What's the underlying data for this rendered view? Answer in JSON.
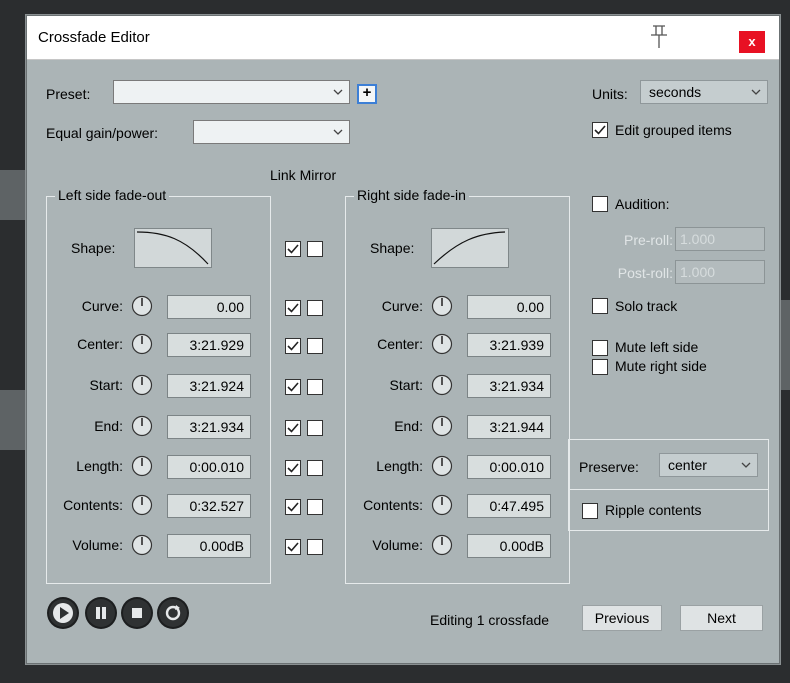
{
  "window": {
    "title": "Crossfade Editor",
    "close_label": "x"
  },
  "preset": {
    "label": "Preset:",
    "value": "",
    "add_label": "+"
  },
  "equal_gain": {
    "label": "Equal gain/power:",
    "value": ""
  },
  "units": {
    "label": "Units:",
    "value": "seconds"
  },
  "edit_grouped": {
    "label": "Edit grouped items",
    "checked": true
  },
  "link_mirror_label": "Link Mirror",
  "left": {
    "title": "Left side fade-out",
    "shape_label": "Shape:",
    "rows": [
      {
        "label": "Curve:",
        "value": "0.00"
      },
      {
        "label": "Center:",
        "value": "3:21.929"
      },
      {
        "label": "Start:",
        "value": "3:21.924"
      },
      {
        "label": "End:",
        "value": "3:21.934"
      },
      {
        "label": "Length:",
        "value": "0:00.010"
      },
      {
        "label": "Contents:",
        "value": "0:32.527"
      },
      {
        "label": "Volume:",
        "value": "0.00dB"
      }
    ]
  },
  "right": {
    "title": "Right side fade-in",
    "shape_label": "Shape:",
    "rows": [
      {
        "label": "Curve:",
        "value": "0.00"
      },
      {
        "label": "Center:",
        "value": "3:21.939"
      },
      {
        "label": "Start:",
        "value": "3:21.934"
      },
      {
        "label": "End:",
        "value": "3:21.944"
      },
      {
        "label": "Length:",
        "value": "0:00.010"
      },
      {
        "label": "Contents:",
        "value": "0:47.495"
      },
      {
        "label": "Volume:",
        "value": "0.00dB"
      }
    ]
  },
  "link_rows": [
    {
      "link": true,
      "mirror": false
    },
    {
      "link": true,
      "mirror": false
    },
    {
      "link": true,
      "mirror": false
    },
    {
      "link": true,
      "mirror": false
    },
    {
      "link": true,
      "mirror": false
    },
    {
      "link": true,
      "mirror": false
    },
    {
      "link": true,
      "mirror": false
    },
    {
      "link": true,
      "mirror": false
    }
  ],
  "audition": {
    "label": "Audition:",
    "checked": false,
    "preroll_label": "Pre-roll:",
    "preroll_value": "1.000",
    "postroll_label": "Post-roll:",
    "postroll_value": "1.000"
  },
  "solo_track": {
    "label": "Solo track",
    "checked": false
  },
  "mute_left": {
    "label": "Mute left side",
    "checked": false
  },
  "mute_right": {
    "label": "Mute right side",
    "checked": false
  },
  "preserve": {
    "label": "Preserve:",
    "value": "center"
  },
  "ripple": {
    "label": "Ripple contents",
    "checked": false
  },
  "footer": {
    "status": "Editing 1 crossfade",
    "previous_label": "Previous",
    "next_label": "Next"
  },
  "transport_icons": [
    "play-icon",
    "pause-icon",
    "stop-icon",
    "loop-icon"
  ],
  "colors": {
    "dialog_bg": "#abb4b6",
    "close_red": "#e81123",
    "accent_blue": "#3c7fd6"
  }
}
